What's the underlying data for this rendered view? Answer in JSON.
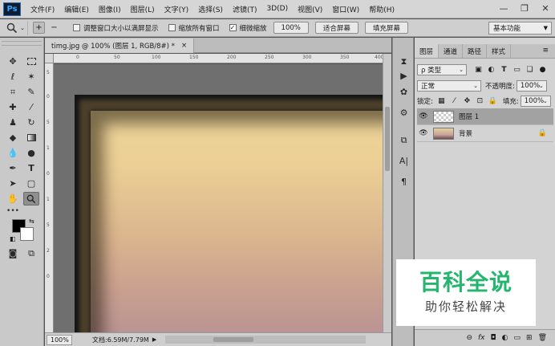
{
  "app": {
    "logo": "Ps"
  },
  "menubar": {
    "items": [
      "文件(F)",
      "编辑(E)",
      "图像(I)",
      "图层(L)",
      "文字(Y)",
      "选择(S)",
      "滤镜(T)",
      "3D(D)",
      "视图(V)",
      "窗口(W)",
      "帮助(H)"
    ],
    "window_controls": {
      "minimize": "—",
      "restore": "❐",
      "close": "✕"
    }
  },
  "optionsbar": {
    "tool_icon": "zoom-icon",
    "zoom_in": "+",
    "zoom_out": "−",
    "check_resize_windows": "调整窗口大小以满屏显示",
    "check_zoom_all": "缩放所有窗口",
    "check_scrubby": "细微缩放",
    "scrubby_checked": true,
    "btn_100": "100%",
    "btn_fit": "适合屏幕",
    "btn_fill": "填充屏幕",
    "workspace": "基本功能"
  },
  "document": {
    "tab_title": "timg.jpg @ 100% (图层 1, RGB/8#) *",
    "tab_close": "×",
    "ruler_h": [
      "0",
      "50",
      "100",
      "150",
      "200",
      "250",
      "300",
      "350",
      "400"
    ],
    "ruler_v": [
      "5",
      "0",
      "5",
      "1",
      "0",
      "1",
      "5",
      "2",
      "0"
    ],
    "zoom": "100%",
    "doc_info": "文档:6.59M/7.79M",
    "colors": {
      "top": "#efd59a",
      "bottom": "#b18c97",
      "frame": "#141414"
    }
  },
  "layers_panel": {
    "tabs": [
      "图层",
      "通道",
      "路径",
      "样式"
    ],
    "filter_kind": "ρ 类型",
    "blend_mode": "正常",
    "opacity_label": "不透明度:",
    "opacity_value": "100%",
    "lock_label": "锁定:",
    "fill_label": "填充:",
    "fill_value": "100%",
    "layers": [
      {
        "name": "图层 1",
        "selected": true,
        "thumb": "checker"
      },
      {
        "name": "背景",
        "selected": false,
        "thumb": "photo",
        "locked": true
      }
    ]
  },
  "watermark": {
    "title": "百科全说",
    "subtitle": "助你轻松解决"
  }
}
